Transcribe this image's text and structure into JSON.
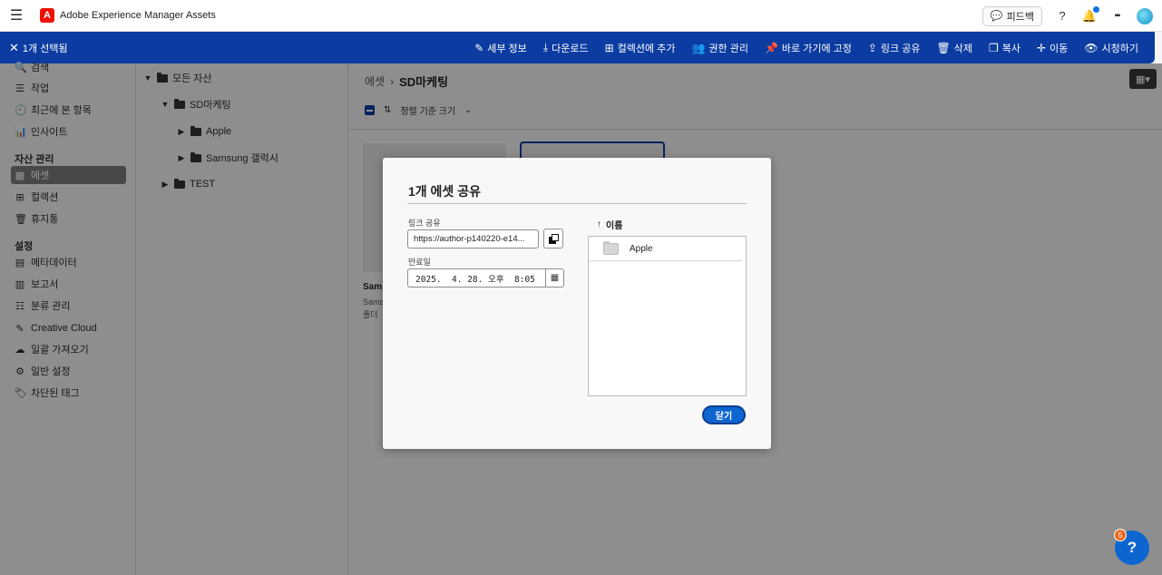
{
  "app": {
    "title": "Adobe Experience Manager Assets",
    "logo_letter": "A"
  },
  "header": {
    "feedback_label": "피드백",
    "help_glyph": "?",
    "notif_glyph": "🔔",
    "apps_glyph": "⋮⋮⋮"
  },
  "selection": {
    "label": "1개 선택됨"
  },
  "actions": [
    {
      "label": "세부 정보",
      "icon": "✎"
    },
    {
      "label": "다운로드",
      "icon": "⤓"
    },
    {
      "label": "컬렉션에 추가",
      "icon": "⊞"
    },
    {
      "label": "권한 관리",
      "icon": "👥"
    },
    {
      "label": "바로 가기에 고정",
      "icon": "📌"
    },
    {
      "label": "링크 공유",
      "icon": "⇪"
    },
    {
      "label": "삭제",
      "icon": "🗑"
    },
    {
      "label": "복사",
      "icon": "❐"
    },
    {
      "label": "이동",
      "icon": "✛"
    },
    {
      "label": "시청하기",
      "icon": "👁"
    }
  ],
  "nav": {
    "items_top": [
      {
        "label": "검색",
        "icon": "🔍"
      },
      {
        "label": "작업",
        "icon": "☰"
      },
      {
        "label": "최근에 본 항목",
        "icon": "🕘"
      },
      {
        "label": "인사이트",
        "icon": "📊"
      }
    ],
    "section_assets": "자산 관리",
    "items_assets": [
      {
        "label": "에셋",
        "icon": "▦"
      },
      {
        "label": "컬렉션",
        "icon": "⊞"
      },
      {
        "label": "휴지통",
        "icon": "🗑"
      }
    ],
    "section_settings": "설정",
    "items_settings": [
      {
        "label": "메타데이터",
        "icon": "▤"
      },
      {
        "label": "보고서",
        "icon": "▥"
      },
      {
        "label": "분류 관리",
        "icon": "☷"
      },
      {
        "label": "Creative Cloud",
        "icon": "✎"
      },
      {
        "label": "일괄 가져오기",
        "icon": "☁"
      },
      {
        "label": "일반 설정",
        "icon": "⚙"
      },
      {
        "label": "차단된 태그",
        "icon": "🏷"
      }
    ]
  },
  "tree": {
    "root": "모든 자산",
    "folder": "SD마케팅",
    "children": [
      "Apple",
      "Samsung 갤럭시"
    ],
    "sibling": "TEST"
  },
  "main": {
    "breadcrumb_root": "에셋",
    "breadcrumb_current": "SD마케팅",
    "sort_label": "정렬 기준 크기",
    "card_title": "Sams",
    "card_sub1": "Sams",
    "card_sub2": "폴더"
  },
  "dialog": {
    "title": "1개 에셋 공유",
    "link_label": "링크 공유",
    "link_value": "https://author-p140220-e14...",
    "expiry_label": "만료일",
    "expiry_value": "2025.  4. 28. 오후  8:05",
    "list_header": "이름",
    "items": [
      "Apple"
    ],
    "close_label": "닫기"
  },
  "help": {
    "badge": "5",
    "glyph": "?"
  }
}
